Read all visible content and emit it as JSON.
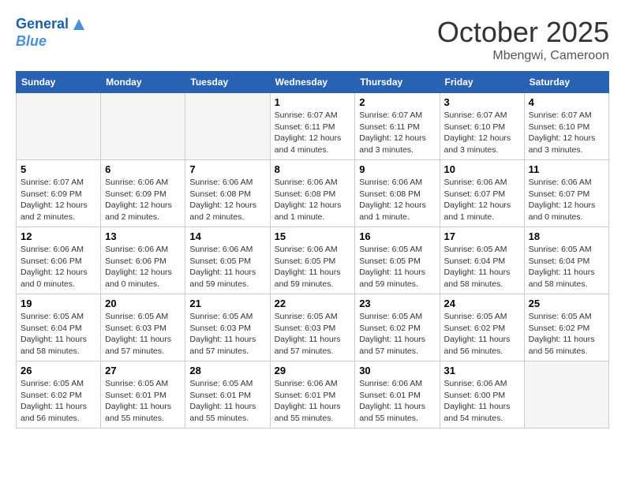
{
  "header": {
    "logo_line1": "General",
    "logo_line2": "Blue",
    "month": "October 2025",
    "location": "Mbengwi, Cameroon"
  },
  "weekdays": [
    "Sunday",
    "Monday",
    "Tuesday",
    "Wednesday",
    "Thursday",
    "Friday",
    "Saturday"
  ],
  "weeks": [
    [
      {
        "day": "",
        "info": ""
      },
      {
        "day": "",
        "info": ""
      },
      {
        "day": "",
        "info": ""
      },
      {
        "day": "1",
        "info": "Sunrise: 6:07 AM\nSunset: 6:11 PM\nDaylight: 12 hours and 4 minutes."
      },
      {
        "day": "2",
        "info": "Sunrise: 6:07 AM\nSunset: 6:11 PM\nDaylight: 12 hours and 3 minutes."
      },
      {
        "day": "3",
        "info": "Sunrise: 6:07 AM\nSunset: 6:10 PM\nDaylight: 12 hours and 3 minutes."
      },
      {
        "day": "4",
        "info": "Sunrise: 6:07 AM\nSunset: 6:10 PM\nDaylight: 12 hours and 3 minutes."
      }
    ],
    [
      {
        "day": "5",
        "info": "Sunrise: 6:07 AM\nSunset: 6:09 PM\nDaylight: 12 hours and 2 minutes."
      },
      {
        "day": "6",
        "info": "Sunrise: 6:06 AM\nSunset: 6:09 PM\nDaylight: 12 hours and 2 minutes."
      },
      {
        "day": "7",
        "info": "Sunrise: 6:06 AM\nSunset: 6:08 PM\nDaylight: 12 hours and 2 minutes."
      },
      {
        "day": "8",
        "info": "Sunrise: 6:06 AM\nSunset: 6:08 PM\nDaylight: 12 hours and 1 minute."
      },
      {
        "day": "9",
        "info": "Sunrise: 6:06 AM\nSunset: 6:08 PM\nDaylight: 12 hours and 1 minute."
      },
      {
        "day": "10",
        "info": "Sunrise: 6:06 AM\nSunset: 6:07 PM\nDaylight: 12 hours and 1 minute."
      },
      {
        "day": "11",
        "info": "Sunrise: 6:06 AM\nSunset: 6:07 PM\nDaylight: 12 hours and 0 minutes."
      }
    ],
    [
      {
        "day": "12",
        "info": "Sunrise: 6:06 AM\nSunset: 6:06 PM\nDaylight: 12 hours and 0 minutes."
      },
      {
        "day": "13",
        "info": "Sunrise: 6:06 AM\nSunset: 6:06 PM\nDaylight: 12 hours and 0 minutes."
      },
      {
        "day": "14",
        "info": "Sunrise: 6:06 AM\nSunset: 6:05 PM\nDaylight: 11 hours and 59 minutes."
      },
      {
        "day": "15",
        "info": "Sunrise: 6:06 AM\nSunset: 6:05 PM\nDaylight: 11 hours and 59 minutes."
      },
      {
        "day": "16",
        "info": "Sunrise: 6:05 AM\nSunset: 6:05 PM\nDaylight: 11 hours and 59 minutes."
      },
      {
        "day": "17",
        "info": "Sunrise: 6:05 AM\nSunset: 6:04 PM\nDaylight: 11 hours and 58 minutes."
      },
      {
        "day": "18",
        "info": "Sunrise: 6:05 AM\nSunset: 6:04 PM\nDaylight: 11 hours and 58 minutes."
      }
    ],
    [
      {
        "day": "19",
        "info": "Sunrise: 6:05 AM\nSunset: 6:04 PM\nDaylight: 11 hours and 58 minutes."
      },
      {
        "day": "20",
        "info": "Sunrise: 6:05 AM\nSunset: 6:03 PM\nDaylight: 11 hours and 57 minutes."
      },
      {
        "day": "21",
        "info": "Sunrise: 6:05 AM\nSunset: 6:03 PM\nDaylight: 11 hours and 57 minutes."
      },
      {
        "day": "22",
        "info": "Sunrise: 6:05 AM\nSunset: 6:03 PM\nDaylight: 11 hours and 57 minutes."
      },
      {
        "day": "23",
        "info": "Sunrise: 6:05 AM\nSunset: 6:02 PM\nDaylight: 11 hours and 57 minutes."
      },
      {
        "day": "24",
        "info": "Sunrise: 6:05 AM\nSunset: 6:02 PM\nDaylight: 11 hours and 56 minutes."
      },
      {
        "day": "25",
        "info": "Sunrise: 6:05 AM\nSunset: 6:02 PM\nDaylight: 11 hours and 56 minutes."
      }
    ],
    [
      {
        "day": "26",
        "info": "Sunrise: 6:05 AM\nSunset: 6:02 PM\nDaylight: 11 hours and 56 minutes."
      },
      {
        "day": "27",
        "info": "Sunrise: 6:05 AM\nSunset: 6:01 PM\nDaylight: 11 hours and 55 minutes."
      },
      {
        "day": "28",
        "info": "Sunrise: 6:05 AM\nSunset: 6:01 PM\nDaylight: 11 hours and 55 minutes."
      },
      {
        "day": "29",
        "info": "Sunrise: 6:06 AM\nSunset: 6:01 PM\nDaylight: 11 hours and 55 minutes."
      },
      {
        "day": "30",
        "info": "Sunrise: 6:06 AM\nSunset: 6:01 PM\nDaylight: 11 hours and 55 minutes."
      },
      {
        "day": "31",
        "info": "Sunrise: 6:06 AM\nSunset: 6:00 PM\nDaylight: 11 hours and 54 minutes."
      },
      {
        "day": "",
        "info": ""
      }
    ]
  ]
}
